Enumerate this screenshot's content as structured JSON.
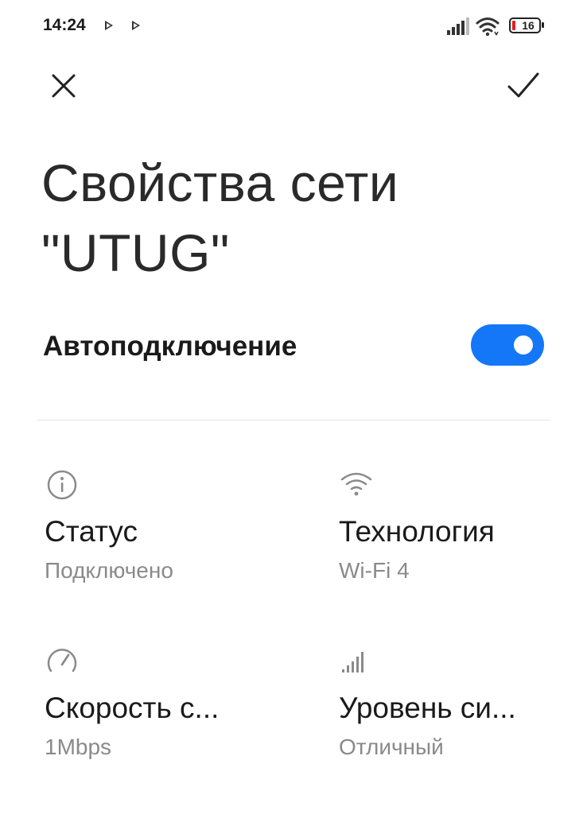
{
  "status_bar": {
    "time": "14:24",
    "battery_level": "16",
    "battery_color": "#e02020"
  },
  "header": {
    "close_icon": "close-icon",
    "confirm_icon": "checkmark-icon"
  },
  "title": "Свойства сети \"UTUG\"",
  "auto_connect": {
    "label": "Автоподключение",
    "enabled": true,
    "accent_color": "#1477f8"
  },
  "details": [
    {
      "icon": "info-icon",
      "title": "Статус",
      "value": "Подключено"
    },
    {
      "icon": "wifi-icon",
      "title": "Технология",
      "value": "Wi-Fi 4"
    },
    {
      "icon": "speedometer-icon",
      "title": "Скорость с...",
      "value": "1Mbps"
    },
    {
      "icon": "signal-bars-icon",
      "title": "Уровень си...",
      "value": "Отличный"
    }
  ]
}
